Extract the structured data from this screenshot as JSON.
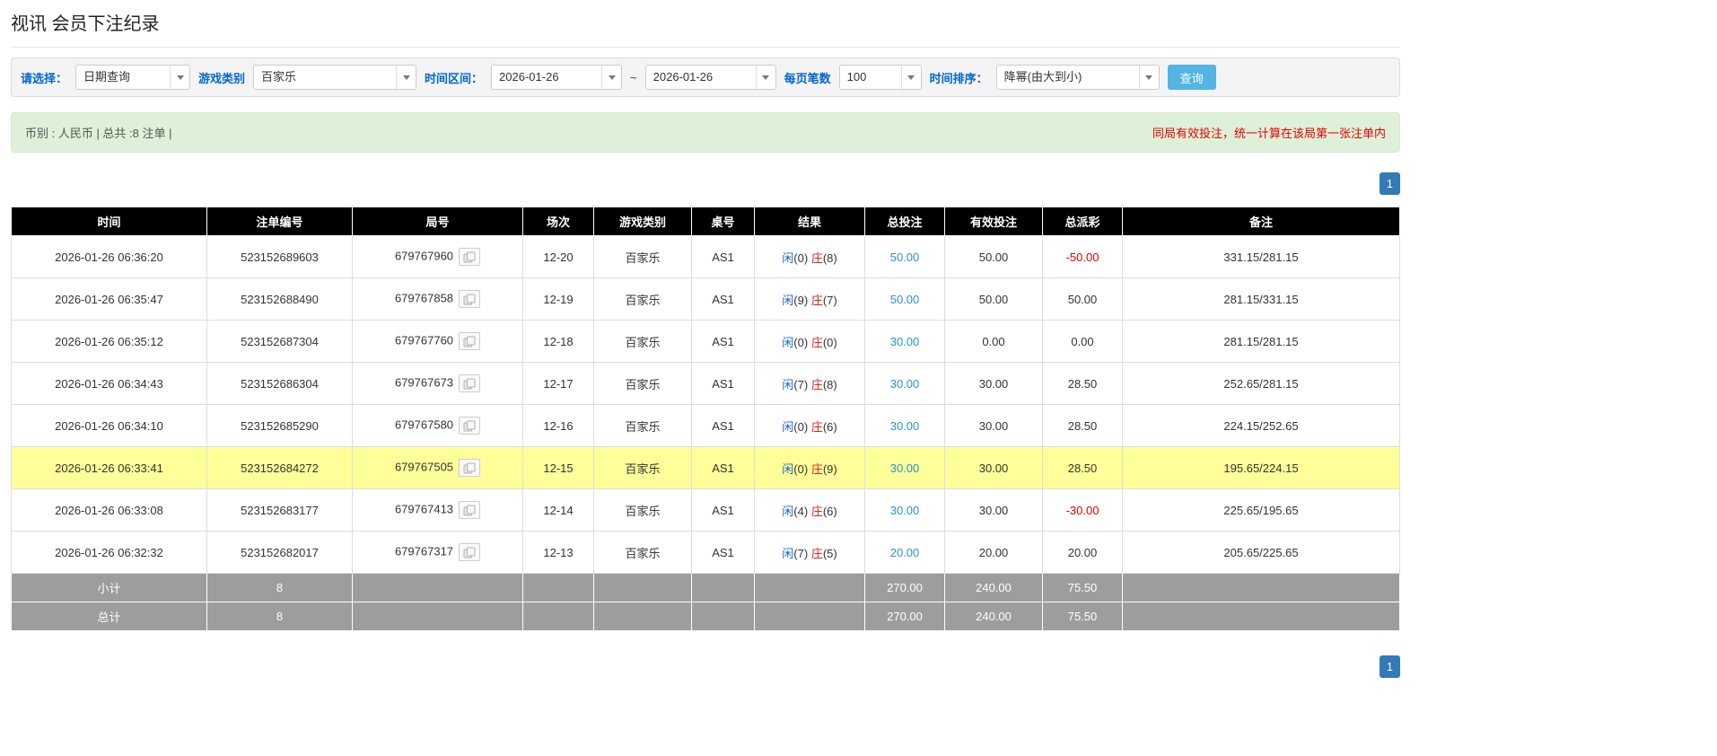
{
  "page": {
    "title": "视讯 会员下注纪录"
  },
  "filters": {
    "select_label": "请选择：",
    "select_value": "日期查询",
    "game_type_label": "游戏类别",
    "game_type_value": "百家乐",
    "time_range_label": "时间区间：",
    "date_from": "2026-01-26",
    "tilde": "~",
    "date_to": "2026-01-26",
    "page_size_label": "每页笔数",
    "page_size_value": "100",
    "sort_label": "时间排序：",
    "sort_value": "降幂(由大到小)",
    "search_button": "查询"
  },
  "summary": {
    "left": "币别 : 人民币 | 总共 :8 注单 |",
    "right": "同局有效投注，统一计算在该局第一张注单内"
  },
  "pagination": {
    "page": "1"
  },
  "colors": {
    "header_bg": "#000000",
    "highlight_row": "#ffff99",
    "link_blue": "#2a91d1",
    "player_blue": "#1a67c9",
    "banker_red": "#dd2222",
    "negative_red": "#e60000",
    "search_button_blue": "#54b4e4",
    "pagination_blue": "#337ab7",
    "summary_bg_green": "#dff0d8",
    "filter_label_blue": "#0066cc"
  },
  "table": {
    "headers": [
      "时间",
      "注单编号",
      "局号",
      "场次",
      "游戏类别",
      "桌号",
      "结果",
      "总投注",
      "有效投注",
      "总派彩",
      "备注"
    ],
    "rows": [
      {
        "time": "2026-01-26 06:36:20",
        "bet_id": "523152689603",
        "round_id": "679767960",
        "session": "12-20",
        "game": "百家乐",
        "table_no": "AS1",
        "player_label": "闲",
        "player_score": "(0)",
        "banker_label": "庄",
        "banker_score": "(8)",
        "total_bet": "50.00",
        "valid_bet": "50.00",
        "payout": "-50.00",
        "note": "331.15/281.15",
        "highlight": false
      },
      {
        "time": "2026-01-26 06:35:47",
        "bet_id": "523152688490",
        "round_id": "679767858",
        "session": "12-19",
        "game": "百家乐",
        "table_no": "AS1",
        "player_label": "闲",
        "player_score": "(9)",
        "banker_label": "庄",
        "banker_score": "(7)",
        "total_bet": "50.00",
        "valid_bet": "50.00",
        "payout": "50.00",
        "note": "281.15/331.15",
        "highlight": false
      },
      {
        "time": "2026-01-26 06:35:12",
        "bet_id": "523152687304",
        "round_id": "679767760",
        "session": "12-18",
        "game": "百家乐",
        "table_no": "AS1",
        "player_label": "闲",
        "player_score": "(0)",
        "banker_label": "庄",
        "banker_score": "(0)",
        "total_bet": "30.00",
        "valid_bet": "0.00",
        "payout": "0.00",
        "note": "281.15/281.15",
        "highlight": false
      },
      {
        "time": "2026-01-26 06:34:43",
        "bet_id": "523152686304",
        "round_id": "679767673",
        "session": "12-17",
        "game": "百家乐",
        "table_no": "AS1",
        "player_label": "闲",
        "player_score": "(7)",
        "banker_label": "庄",
        "banker_score": "(8)",
        "total_bet": "30.00",
        "valid_bet": "30.00",
        "payout": "28.50",
        "note": "252.65/281.15",
        "highlight": false
      },
      {
        "time": "2026-01-26 06:34:10",
        "bet_id": "523152685290",
        "round_id": "679767580",
        "session": "12-16",
        "game": "百家乐",
        "table_no": "AS1",
        "player_label": "闲",
        "player_score": "(0)",
        "banker_label": "庄",
        "banker_score": "(6)",
        "total_bet": "30.00",
        "valid_bet": "30.00",
        "payout": "28.50",
        "note": "224.15/252.65",
        "highlight": false
      },
      {
        "time": "2026-01-26 06:33:41",
        "bet_id": "523152684272",
        "round_id": "679767505",
        "session": "12-15",
        "game": "百家乐",
        "table_no": "AS1",
        "player_label": "闲",
        "player_score": "(0)",
        "banker_label": "庄",
        "banker_score": "(9)",
        "total_bet": "30.00",
        "valid_bet": "30.00",
        "payout": "28.50",
        "note": "195.65/224.15",
        "highlight": true
      },
      {
        "time": "2026-01-26 06:33:08",
        "bet_id": "523152683177",
        "round_id": "679767413",
        "session": "12-14",
        "game": "百家乐",
        "table_no": "AS1",
        "player_label": "闲",
        "player_score": "(4)",
        "banker_label": "庄",
        "banker_score": "(6)",
        "total_bet": "30.00",
        "valid_bet": "30.00",
        "payout": "-30.00",
        "note": "225.65/195.65",
        "highlight": false
      },
      {
        "time": "2026-01-26 06:32:32",
        "bet_id": "523152682017",
        "round_id": "679767317",
        "session": "12-13",
        "game": "百家乐",
        "table_no": "AS1",
        "player_label": "闲",
        "player_score": "(7)",
        "banker_label": "庄",
        "banker_score": "(5)",
        "total_bet": "20.00",
        "valid_bet": "20.00",
        "payout": "20.00",
        "note": "205.65/225.65",
        "highlight": false
      }
    ],
    "footer": [
      {
        "label": "小计",
        "count": "8",
        "total_bet": "270.00",
        "valid_bet": "240.00",
        "payout": "75.50"
      },
      {
        "label": "总计",
        "count": "8",
        "total_bet": "270.00",
        "valid_bet": "240.00",
        "payout": "75.50"
      }
    ]
  }
}
